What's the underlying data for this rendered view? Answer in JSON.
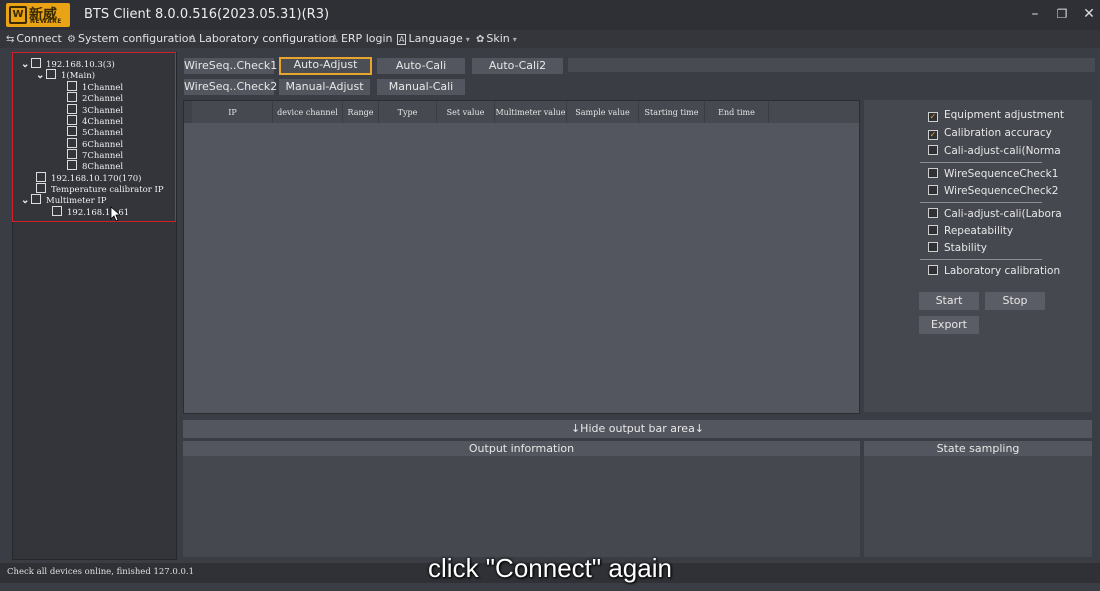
{
  "app": {
    "logo_cn": "新威",
    "logo_en": "NEWARE",
    "logo_mark": "W",
    "title": "BTS Client 8.0.0.516(2023.05.31)(R3)"
  },
  "window_controls": {
    "minimize": "–",
    "restore": "❐",
    "close": "✕"
  },
  "menu": [
    {
      "icon": "⇆",
      "label": "Connect",
      "caret": ""
    },
    {
      "icon": "⚙",
      "label": "System configuration",
      "caret": ""
    },
    {
      "icon": "♙",
      "label": "Laboratory configuration",
      "caret": ""
    },
    {
      "icon": "♙",
      "label": "ERP login",
      "caret": ""
    },
    {
      "icon": "A",
      "label": "Language",
      "caret": "▾"
    },
    {
      "icon": "✿",
      "label": "Skin",
      "caret": "▾"
    }
  ],
  "tree": [
    {
      "label": "192.168.10.3(3)",
      "expanded": true
    },
    {
      "label": "1(Main)",
      "expanded": true
    },
    {
      "label": "1Channel"
    },
    {
      "label": "2Channel"
    },
    {
      "label": "3Channel"
    },
    {
      "label": "4Channel"
    },
    {
      "label": "5Channel"
    },
    {
      "label": "6Channel"
    },
    {
      "label": "7Channel"
    },
    {
      "label": "8Channel"
    },
    {
      "label": "192.168.10.170(170)"
    },
    {
      "label": "Temperature calibrator IP"
    },
    {
      "label": "Multimeter IP",
      "expanded": true
    },
    {
      "label": "192.168.10.61"
    }
  ],
  "tabs_row1": [
    "WireSeq..Check1",
    "Auto-Adjust",
    "Auto-Cali",
    "Auto-Cali2"
  ],
  "tabs_row2": [
    "WireSeq..Check2",
    "Manual-Adjust",
    "Manual-Cali"
  ],
  "active_tab": "Auto-Adjust",
  "table": {
    "columns": [
      "IP",
      "device channel",
      "Range",
      "Type",
      "Set value",
      "Multimeter value",
      "Sample value",
      "Starting time",
      "End time"
    ]
  },
  "options": [
    {
      "label": "Equipment adjustment",
      "checked": true
    },
    {
      "label": "Calibration accuracy",
      "checked": true
    },
    {
      "label": "Cali-adjust-cali(Norma",
      "checked": false
    },
    {
      "label": "WireSequenceCheck1",
      "checked": false
    },
    {
      "label": "WireSequenceCheck2",
      "checked": false
    },
    {
      "label": "Cali-adjust-cali(Labora",
      "checked": false
    },
    {
      "label": "Repeatability",
      "checked": false
    },
    {
      "label": "Stability",
      "checked": false
    },
    {
      "label": "Laboratory calibration",
      "checked": false
    }
  ],
  "buttons": {
    "start": "Start",
    "stop": "Stop",
    "export": "Export"
  },
  "output": {
    "hide_bar": "↓Hide output bar area↓",
    "output_info": "Output information",
    "state_sampling": "State sampling"
  },
  "status": {
    "text": "Check all devices online, finished 127.0.0.1"
  },
  "caption": "click \"Connect\" again",
  "colors": {
    "accent": "#e8a52e",
    "highlight_box": "#d0202a",
    "logo_bg": "#e9a314"
  }
}
